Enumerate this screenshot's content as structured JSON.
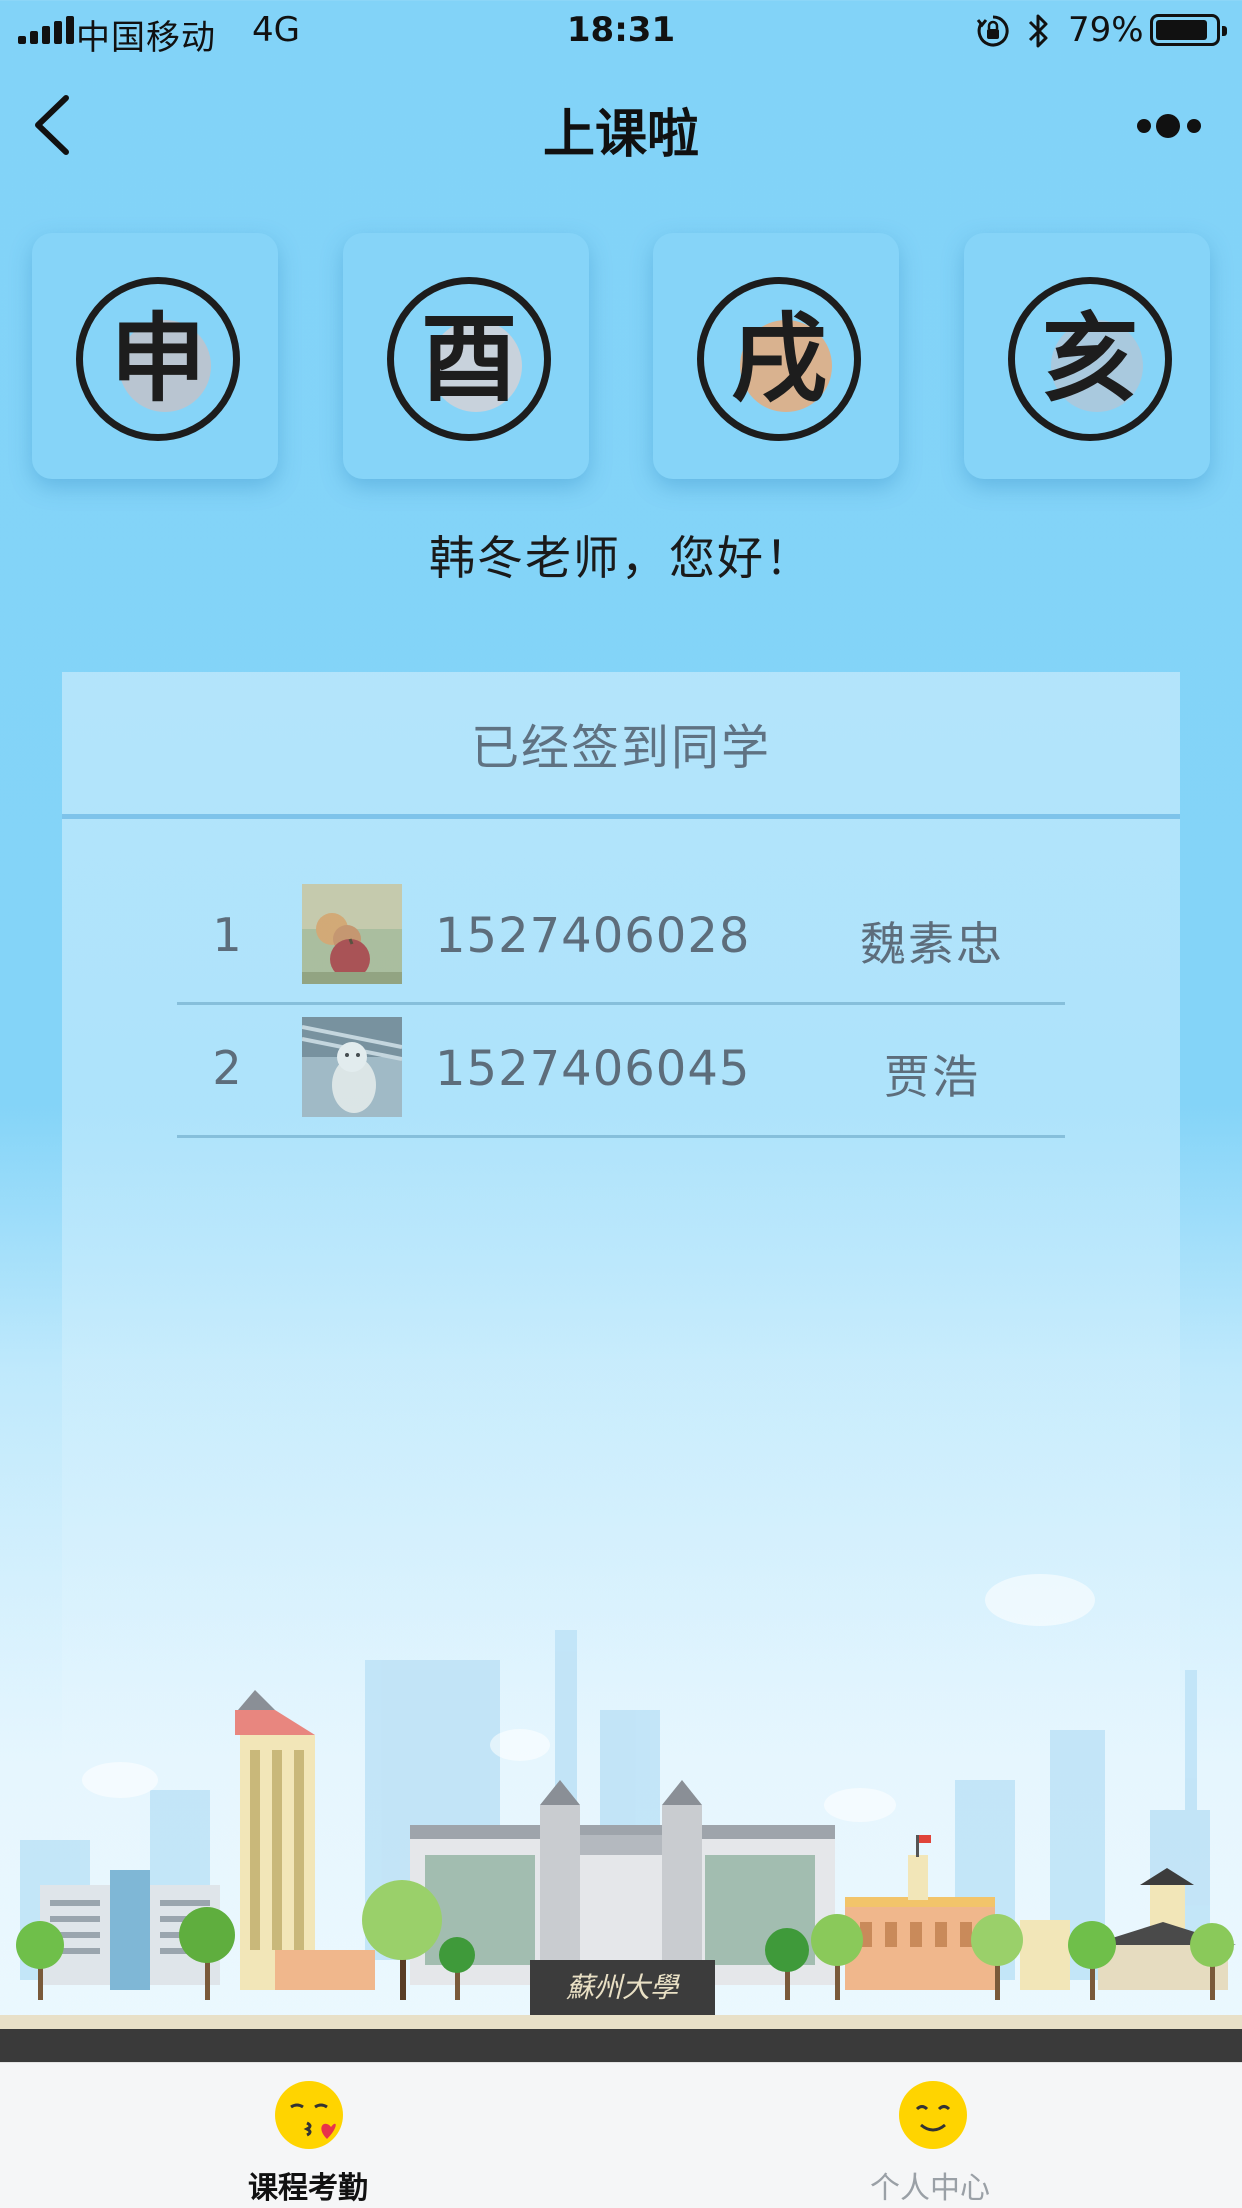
{
  "status_bar": {
    "carrier": "中国移动",
    "network": "4G",
    "time": "18:31",
    "battery": "79%",
    "battery_level": 0.79
  },
  "nav": {
    "title": "上课啦",
    "back_icon": "chevron-left-icon",
    "more_icon": "more-dots-icon"
  },
  "zodiac_tiles": [
    {
      "glyph": "申",
      "color": "#b9c5d1"
    },
    {
      "glyph": "酉",
      "color": "#c8d2dc"
    },
    {
      "glyph": "戌",
      "color": "#d9b28f"
    },
    {
      "glyph": "亥",
      "color": "#a9c9de"
    }
  ],
  "greeting": "韩冬老师，您好！",
  "panel": {
    "title": "已经签到同学",
    "students": [
      {
        "index": "1",
        "id": "1527406028",
        "name": "魏素忠",
        "avatar": "apple-photo"
      },
      {
        "index": "2",
        "id": "1527406045",
        "name": "贾浩",
        "avatar": "dog-photo"
      }
    ]
  },
  "skyline": {
    "gate_sign": "蘇州大學"
  },
  "tabs": [
    {
      "label": "课程考勤",
      "icon": "kiss-emoji-icon",
      "active": true
    },
    {
      "label": "个人中心",
      "icon": "smile-emoji-icon",
      "active": false
    }
  ],
  "colors": {
    "accent": "#84d4f8",
    "divider": "#7ec3ea",
    "text_muted": "#5d6d7b"
  }
}
